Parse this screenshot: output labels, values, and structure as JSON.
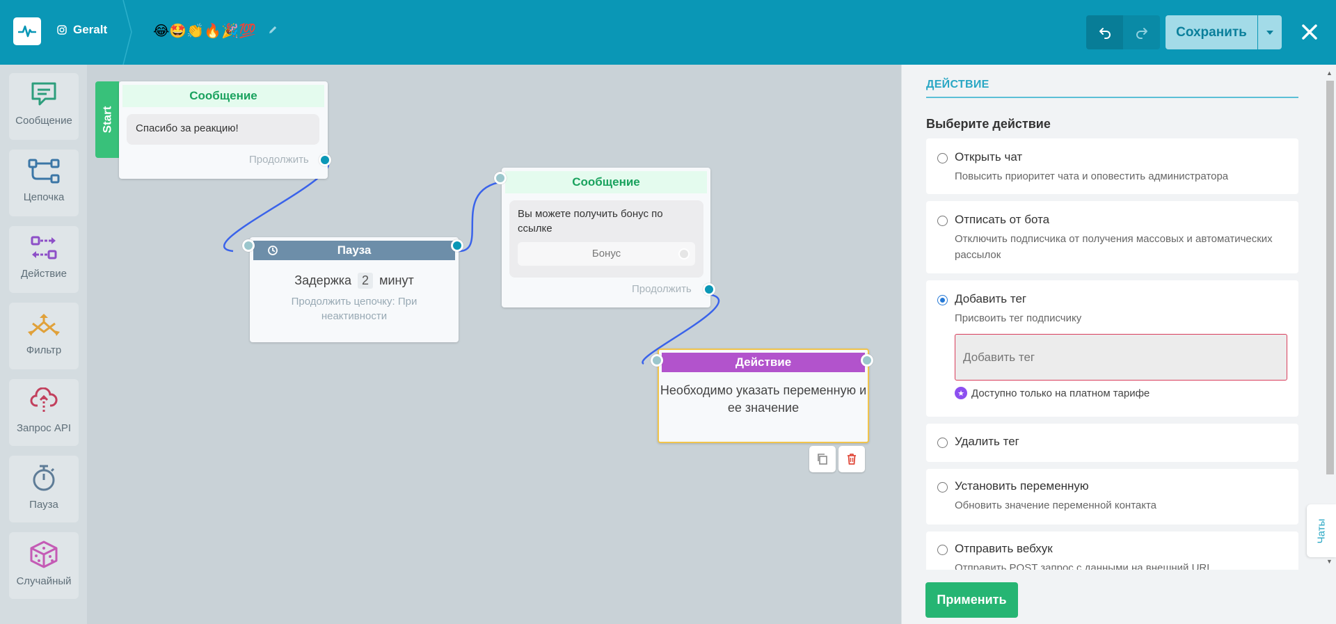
{
  "header": {
    "account_name": "Geralt",
    "flow_name_emojis": "😂🤩👏🔥🎉💯",
    "save_label": "Сохранить"
  },
  "palette": [
    {
      "label": "Сообщение",
      "icon": "message-icon"
    },
    {
      "label": "Цепочка",
      "icon": "chain-icon"
    },
    {
      "label": "Действие",
      "icon": "action-icon"
    },
    {
      "label": "Фильтр",
      "icon": "filter-icon"
    },
    {
      "label": "Запрос API",
      "icon": "api-request-icon"
    },
    {
      "label": "Пауза",
      "icon": "stopwatch-icon"
    },
    {
      "label": "Случайный",
      "icon": "dice-icon"
    }
  ],
  "canvas": {
    "start_label": "Start",
    "node1": {
      "title": "Сообщение",
      "text": "Спасибо за реакцию!",
      "continue": "Продолжить"
    },
    "pause": {
      "title": "Пауза",
      "delay_prefix": "Задержка",
      "delay_value": "2",
      "delay_unit": "минут",
      "sub": "Продолжить цепочку: При неактивности"
    },
    "node2": {
      "title": "Сообщение",
      "text": "Вы можете получить бонус по ссылке",
      "button": "Бонус",
      "continue": "Продолжить"
    },
    "action": {
      "title": "Действие",
      "text": "Необходимо указать переменную и ее значение"
    }
  },
  "panel": {
    "title": "ДЕЙСТВИЕ",
    "subtitle": "Выберите действие",
    "options": [
      {
        "title": "Открыть чат",
        "desc": "Повысить приоритет чата и оповестить администратора",
        "selected": false
      },
      {
        "title": "Отписать от бота",
        "desc": "Отключить подписчика от получения массовых и автоматических рассылок",
        "selected": false
      },
      {
        "title": "Добавить тег",
        "desc": "Присвоить тег подписчику",
        "selected": true
      },
      {
        "title": "Удалить тег",
        "desc": "",
        "selected": false
      },
      {
        "title": "Установить переменную",
        "desc": "Обновить значение переменной контакта",
        "selected": false
      },
      {
        "title": "Отправить вебхук",
        "desc": "Отправить POST запрос с данными на внешний URL",
        "selected": false
      }
    ],
    "tag_placeholder": "Добавить тег",
    "paid_note": "Доступно только на платном тарифе",
    "apply_label": "Применить",
    "chats_tab": "Чаты"
  },
  "colors": {
    "header_bg": "#0a97b6",
    "green": "#26b573",
    "purple": "#b253cc",
    "pause_blue": "#6d8ea9",
    "accent_blue": "#2aa7c4"
  }
}
